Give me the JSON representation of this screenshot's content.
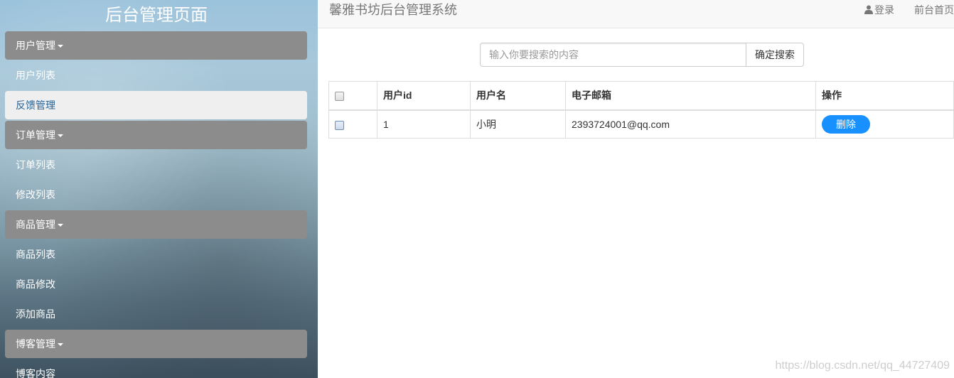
{
  "sidebar": {
    "title": "后台管理页面",
    "groups": [
      {
        "label": "用户管理",
        "items": [
          "用户列表",
          "反馈管理"
        ]
      },
      {
        "label": "订单管理",
        "items": [
          "订单列表",
          "修改列表"
        ]
      },
      {
        "label": "商品管理",
        "items": [
          "商品列表",
          "商品修改",
          "添加商品"
        ]
      },
      {
        "label": "博客管理",
        "items": [
          "博客内容"
        ]
      }
    ],
    "active_item": "反馈管理"
  },
  "header": {
    "brand": "馨雅书坊后台管理系统",
    "login": "登录",
    "frontpage": "前台首页"
  },
  "search": {
    "placeholder": "输入你要搜索的内容",
    "button": "确定搜索"
  },
  "table": {
    "columns": [
      "",
      "用户id",
      "用户名",
      "电子邮箱",
      "操作"
    ],
    "rows": [
      {
        "id": "1",
        "name": "小明",
        "email": "2393724001@qq.com",
        "action": "删除"
      }
    ]
  },
  "watermark": "https://blog.csdn.net/qq_44727409",
  "colors": {
    "accent": "#1890ff",
    "nav_group": "#8c8c8c"
  }
}
